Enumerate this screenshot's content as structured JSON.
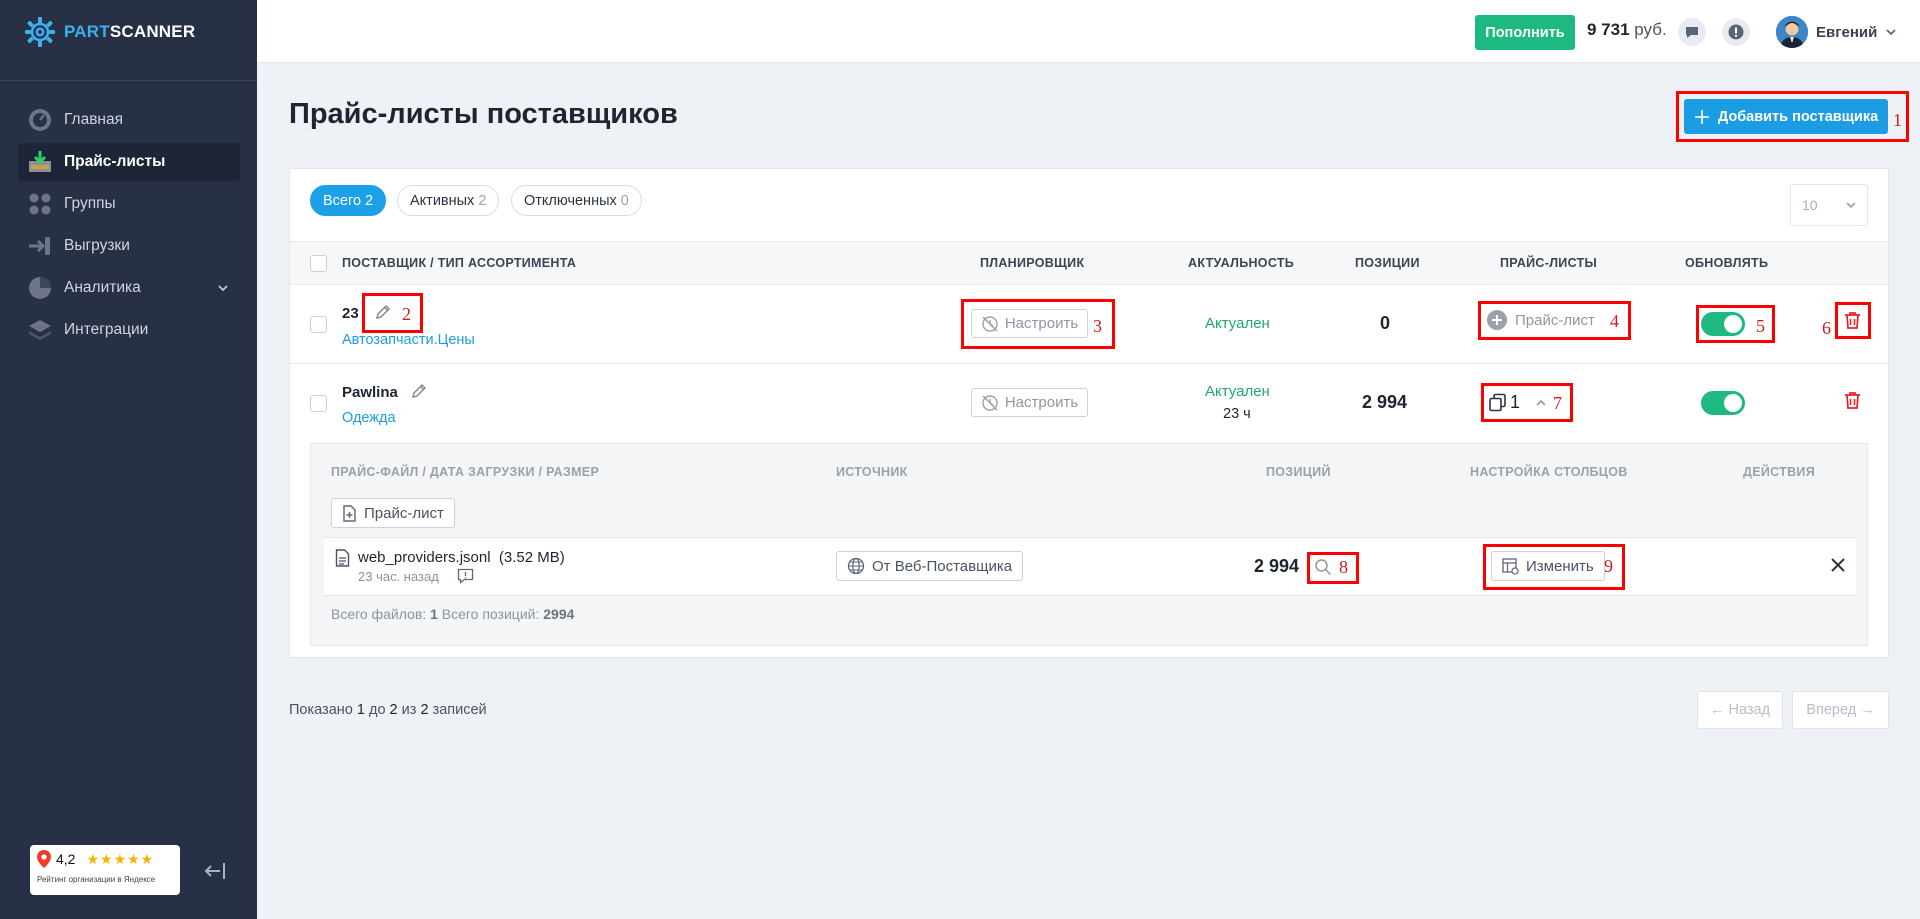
{
  "brand": {
    "name_part1": "PART",
    "name_part2": "SCANNER"
  },
  "sidebar": {
    "items": [
      {
        "label": "Главная",
        "icon": "dashboard-icon"
      },
      {
        "label": "Прайс-листы",
        "icon": "price-list-icon",
        "active": true
      },
      {
        "label": "Группы",
        "icon": "groups-icon"
      },
      {
        "label": "Выгрузки",
        "icon": "export-icon"
      },
      {
        "label": "Аналитика",
        "icon": "analytics-icon",
        "has_submenu": true
      },
      {
        "label": "Интеграции",
        "icon": "integrations-icon"
      }
    ],
    "rating": {
      "value": "4,2",
      "stars": "★★★★★",
      "caption": "Рейтинг организации в Яндексе"
    }
  },
  "header": {
    "topup_label": "Пополнить",
    "balance_amount": "9 731",
    "balance_currency": "руб.",
    "user_name": "Евгений"
  },
  "page": {
    "title": "Прайс-листы поставщиков",
    "add_button": "Добавить поставщика"
  },
  "filters": [
    {
      "label": "Всего",
      "count": "2",
      "active": true
    },
    {
      "label": "Активных",
      "count": "2"
    },
    {
      "label": "Отключенных",
      "count": "0"
    }
  ],
  "per_page": "10",
  "table": {
    "headers": {
      "provider": "ПОСТАВЩИК / ТИП АССОРТИМЕНТА",
      "scheduler": "ПЛАНИРОВЩИК",
      "actuality": "АКТУАЛЬНОСТЬ",
      "positions": "ПОЗИЦИИ",
      "price_lists": "ПРАЙС-ЛИСТЫ",
      "update": "ОБНОВЛЯТЬ"
    },
    "rows": [
      {
        "name": "23",
        "type": "Автозапчасти.Цены",
        "scheduler": "Настроить",
        "actuality": "Актуален",
        "actuality_age": "",
        "positions": "0",
        "price_list": "Прайс-лист"
      },
      {
        "name": "Pawlina",
        "type": "Одежда",
        "scheduler": "Настроить",
        "actuality": "Актуален",
        "actuality_age": "23 ч",
        "positions": "2 994",
        "price_list_count": "1"
      }
    ]
  },
  "files": {
    "headers": {
      "file": "ПРАЙС-ФАЙЛ / ДАТА ЗАГРУЗКИ / РАЗМЕР",
      "source": "ИСТОЧНИК",
      "positions": "ПОЗИЦИЙ",
      "columns": "НАСТРОЙКА СТОЛБЦОВ",
      "actions": "ДЕЙСТВИЯ"
    },
    "add_button": "Прайс-лист",
    "items": [
      {
        "filename": "web_providers.jsonl",
        "size": "(3.52 MB)",
        "uploaded": "23 час. назад",
        "source": "От Веб-Поставщика",
        "positions": "2 994",
        "columns_button": "Изменить"
      }
    ],
    "summary_files_label": "Всего файлов:",
    "summary_files": "1",
    "summary_positions_label": "Всего позиций:",
    "summary_positions": "2994"
  },
  "pagination": {
    "shown_prefix": "Показано",
    "from": "1",
    "to_label": "до",
    "to": "2",
    "of_label": "из",
    "total": "2",
    "suffix": "записей",
    "prev": "← Назад",
    "next": "Вперед →"
  },
  "annotations": [
    "1",
    "2",
    "3",
    "4",
    "5",
    "6",
    "7",
    "8",
    "9"
  ],
  "colors": {
    "sidebar": "#283046",
    "primary": "#1c9de3",
    "success": "#1db980",
    "danger": "#e0242c",
    "marker": "#ff0000"
  }
}
